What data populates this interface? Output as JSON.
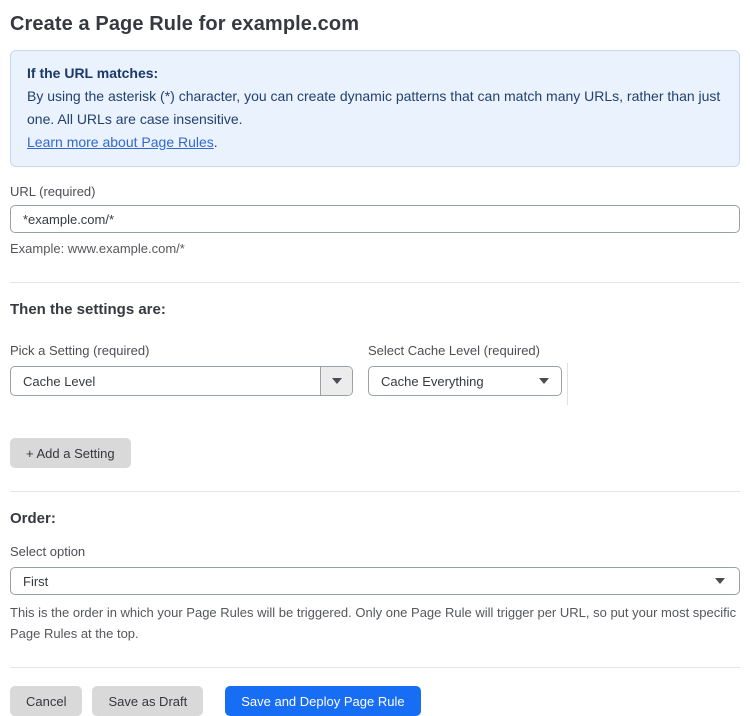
{
  "page": {
    "title": "Create a Page Rule for example.com"
  },
  "info_box": {
    "heading": "If the URL matches:",
    "body_line": "By using the asterisk (*) character, you can create dynamic patterns that can match many URLs, rather than just one. All URLs are case insensitive.",
    "link_label": "Learn more about Page Rules",
    "link_suffix": "."
  },
  "url_field": {
    "label": "URL (required)",
    "value": "*example.com/*",
    "hint": "Example: www.example.com/*"
  },
  "settings": {
    "heading": "Then the settings are:",
    "pick_setting": {
      "label": "Pick a Setting (required)",
      "value": "Cache Level"
    },
    "cache_level": {
      "label": "Select Cache Level (required)",
      "value": "Cache Everything"
    },
    "add_button_label": "+ Add a Setting"
  },
  "order": {
    "heading": "Order:",
    "label": "Select option",
    "value": "First",
    "hint": "This is the order in which your Page Rules will be triggered. Only one Page Rule will trigger per URL, so put your most specific Page Rules at the top."
  },
  "footer": {
    "cancel_label": "Cancel",
    "save_draft_label": "Save as Draft",
    "save_deploy_label": "Save and Deploy Page Rule"
  },
  "colors": {
    "info_box_bg": "#e9f2fd",
    "info_box_border": "#c3d9f4",
    "info_text": "#23406f",
    "link_blue": "#3268d0",
    "primary_button_blue": "#186df5",
    "gray_button": "#d9d9d9",
    "input_border": "#9aa0a8",
    "divider": "#e4e5e7"
  },
  "icons": {
    "dropdown_arrow": "▼"
  }
}
